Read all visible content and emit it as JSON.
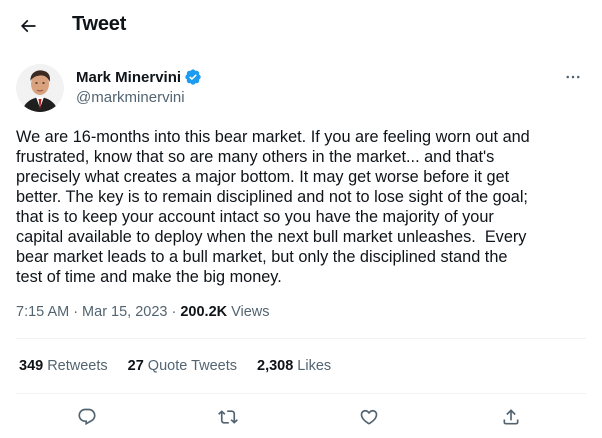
{
  "header": {
    "title": "Tweet",
    "back_icon": "arrow-left-icon"
  },
  "author": {
    "display_name": "Mark Minervini",
    "handle": "@markminervini",
    "verified": true,
    "verified_color": "#1d9bf0",
    "avatar_icon": "profile-photo"
  },
  "more_icon": "more-horizontal-icon",
  "tweet": {
    "text": "We are 16-months into this bear market. If you are feeling worn out and\nfrustrated, know that so are many others in the market... and that's\nprecisely what creates a major bottom. It may get worse before it get\nbetter. The key is to remain disciplined and not to lose sight of the goal;\nthat is to keep your account intact so you have the majority of your\ncapital available to deploy when the next bull market unleashes.  Every\nbear market leads to a bull market, but only the disciplined stand the\ntest of time and make the big money."
  },
  "meta": {
    "time": "7:15 AM",
    "separator": "·",
    "date": "Mar 15, 2023",
    "views_count": "200.2K",
    "views_label": "Views"
  },
  "stats": [
    {
      "count": "349",
      "label": "Retweets"
    },
    {
      "count": "27",
      "label": "Quote Tweets"
    },
    {
      "count": "2,308",
      "label": "Likes"
    }
  ],
  "actions": [
    {
      "icon": "reply-icon"
    },
    {
      "icon": "retweet-icon"
    },
    {
      "icon": "like-icon"
    },
    {
      "icon": "share-icon"
    }
  ],
  "colors": {
    "text_primary": "#0f1419",
    "text_secondary": "#536471",
    "divider": "#eff3f4",
    "accent": "#1d9bf0"
  }
}
